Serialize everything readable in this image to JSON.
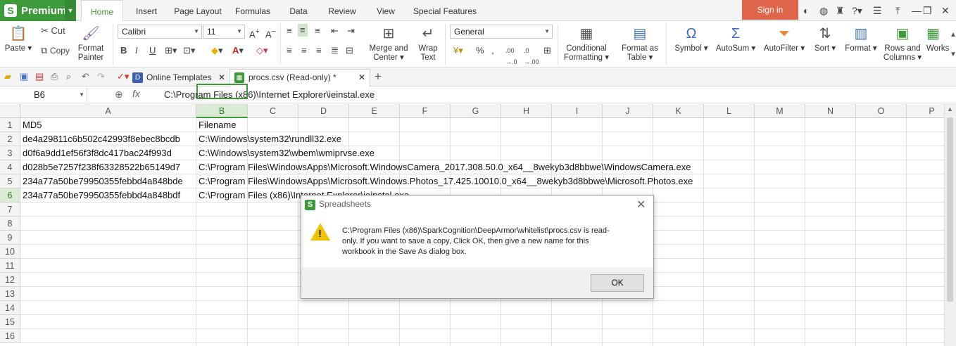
{
  "brand": {
    "label": "Premium",
    "logo": "S"
  },
  "menu_tabs": [
    "Home",
    "Insert",
    "Page Layout",
    "Formulas",
    "Data",
    "Review",
    "View",
    "Special Features"
  ],
  "signin": "Sign in",
  "ribbon": {
    "paste": "Paste",
    "cut": "Cut",
    "copy": "Copy",
    "format_painter_1": "Format",
    "format_painter_2": "Painter",
    "font_name": "Calibri",
    "font_size": "11",
    "merge_1": "Merge and",
    "merge_2": "Center",
    "wrap_1": "Wrap",
    "wrap_2": "Text",
    "number_format": "General",
    "cond_1": "Conditional",
    "cond_2": "Formatting",
    "fmt_table_1": "Format as",
    "fmt_table_2": "Table",
    "symbol": "Symbol",
    "autosum": "AutoSum",
    "autofilter": "AutoFilter",
    "sort": "Sort",
    "format": "Format",
    "rows_cols_1": "Rows and",
    "rows_cols_2": "Columns",
    "works": "Works"
  },
  "doc_tabs": {
    "online": "Online Templates",
    "procs": "procs.csv (Read-only) *"
  },
  "formula_bar": {
    "cell_ref": "B6",
    "formula": "C:\\Program Files (x86)\\Internet Explorer\\ieinstal.exe"
  },
  "columns": [
    "A",
    "B",
    "C",
    "D",
    "E",
    "F",
    "G",
    "H",
    "I",
    "J",
    "K",
    "L",
    "M",
    "N",
    "O",
    "P"
  ],
  "rows": [
    "1",
    "2",
    "3",
    "4",
    "5",
    "6",
    "7",
    "8",
    "9",
    "10",
    "11",
    "12",
    "13",
    "14",
    "15",
    "16"
  ],
  "cells": {
    "A1": "MD5",
    "B1": "Filename",
    "A2": "de4a29811c6b502c42993f8ebec8bcdb",
    "B2": "C:\\Windows\\system32\\rundll32.exe",
    "A3": "d0f6a9dd1ef56f3f8dc417bac24f993d",
    "B3": "C:\\Windows\\system32\\wbem\\wmiprvse.exe",
    "A4": "d028b5e7257f238f63328522b65149d7",
    "B4": "C:\\Program Files\\WindowsApps\\Microsoft.WindowsCamera_2017.308.50.0_x64__8wekyb3d8bbwe\\WindowsCamera.exe",
    "A5": "234a77a50be79950355febbd4a848bde",
    "B5": "C:\\Program Files\\WindowsApps\\Microsoft.Windows.Photos_17.425.10010.0_x64__8wekyb3d8bbwe\\Microsoft.Photos.exe",
    "A6": "234a77a50be79950355febbd4a848bdf",
    "B6": "C:\\Program Files (x86)\\Internet Explorer\\ieinstal.exe"
  },
  "dialog": {
    "title": "Spreadsheets",
    "message_1": "C:\\Program Files (x86)\\SparkCognition\\DeepArmor\\whitelist\\procs.csv is read-",
    "message_2": "only.  If you want to save a copy,  Click OK,  then give a new name for this",
    "message_3": "workbook in the Save As dialog box.",
    "ok": "OK"
  }
}
